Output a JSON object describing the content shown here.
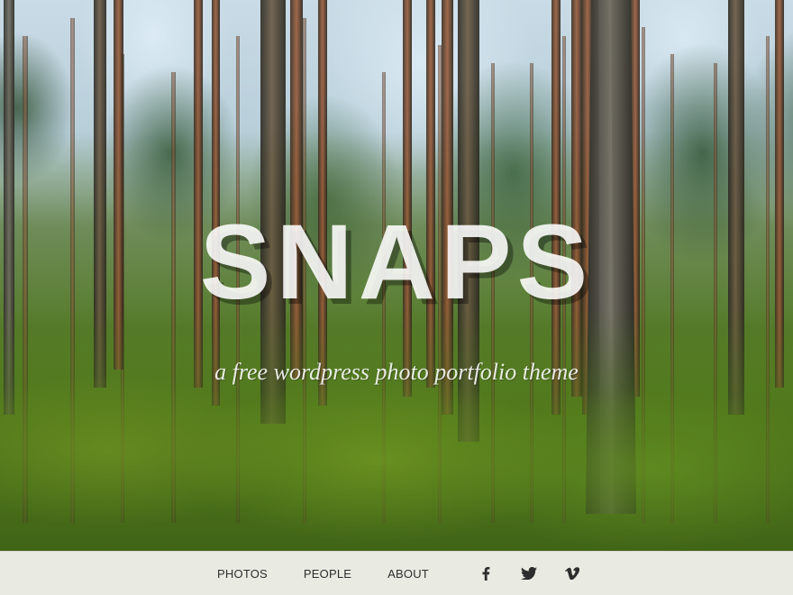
{
  "site": {
    "title": "SNAPS",
    "tagline": "a free wordpress photo portfolio theme"
  },
  "nav": {
    "links": [
      {
        "label": "PHOTOS"
      },
      {
        "label": "PEOPLE"
      },
      {
        "label": "ABOUT"
      }
    ],
    "social": [
      {
        "icon": "facebook-icon"
      },
      {
        "icon": "twitter-icon"
      },
      {
        "icon": "vimeo-icon"
      }
    ]
  },
  "colors": {
    "nav_bg": "#F0F0EC",
    "nav_text": "#2D2D2D",
    "hero_text": "#FFFFFF"
  }
}
